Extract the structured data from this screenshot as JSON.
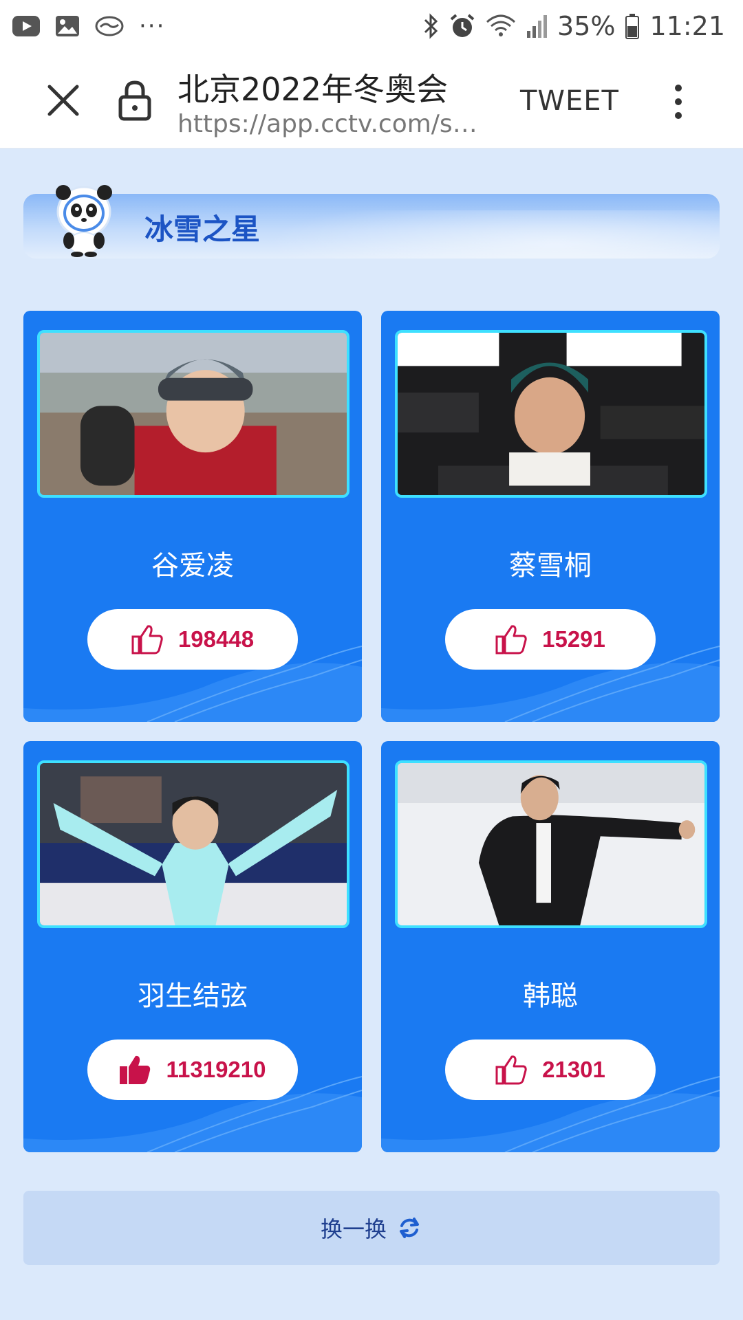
{
  "status_bar": {
    "battery": "35%",
    "time": "11:21",
    "more": "···",
    "left_icons": [
      "youtube-icon",
      "gallery-icon",
      "handshake-icon"
    ],
    "right_icons": [
      "bluetooth-icon",
      "alarm-icon",
      "wifi-icon",
      "signal-icon",
      "battery-icon"
    ]
  },
  "toolbar": {
    "title": "北京2022年冬奥会",
    "url": "https://app.cctv.com/sp…",
    "tweet_label": "TWEET",
    "icons": [
      "close-icon",
      "lock-icon",
      "more-vert-icon"
    ]
  },
  "section": {
    "title": "冰雪之星"
  },
  "athletes": [
    {
      "name": "谷爱凌",
      "likes": "198448",
      "liked": false
    },
    {
      "name": "蔡雪桐",
      "likes": "15291",
      "liked": false
    },
    {
      "name": "羽生结弦",
      "likes": "11319210",
      "liked": true
    },
    {
      "name": "韩聪",
      "likes": "21301",
      "liked": false
    }
  ],
  "refresh": {
    "label": "换一换"
  },
  "colors": {
    "card_bg": "#1a7af2",
    "photo_border": "#3ee0ff",
    "like_text": "#c8124a",
    "page_bg": "#dbe9fb",
    "title_blue": "#1c54c4"
  }
}
